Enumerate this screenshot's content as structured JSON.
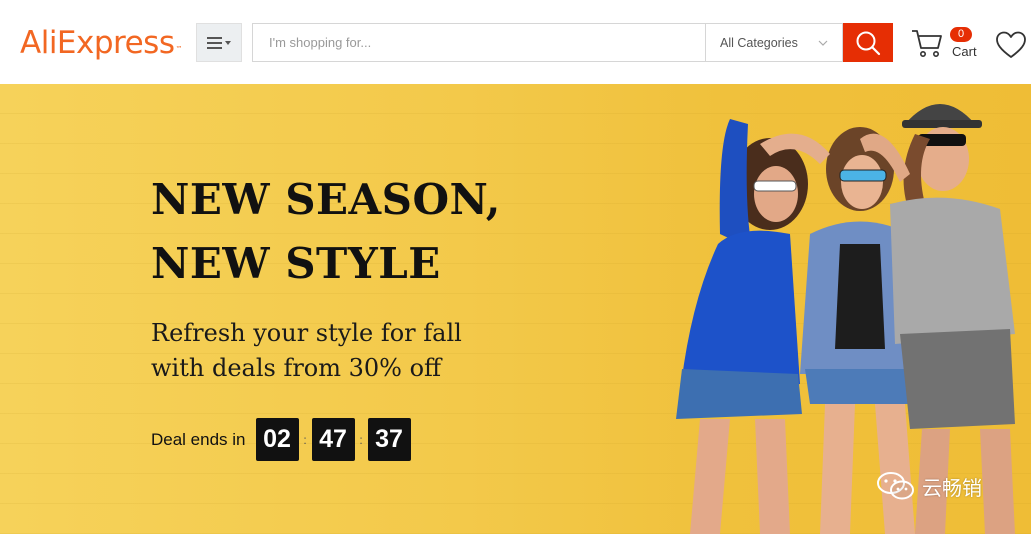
{
  "header": {
    "logo_text": "AliExpress",
    "logo_tm": "™",
    "menu_icon": "hamburger-dropdown-icon",
    "search": {
      "placeholder": "I'm shopping for..."
    },
    "category_select": {
      "selected": "All Categories"
    },
    "search_button_icon": "search-icon",
    "cart": {
      "count": "0",
      "label": "Cart"
    },
    "wishlist_icon": "heart-icon"
  },
  "hero": {
    "headline": [
      "NEW SEASON,",
      "NEW STYLE"
    ],
    "subtitle": [
      "Refresh your style for fall",
      "with deals from 30% off"
    ],
    "deal_label": "Deal ends in",
    "countdown": [
      "02",
      "47",
      "37"
    ]
  },
  "watermark": {
    "text": "云畅销"
  },
  "colors": {
    "brand": "#f26722",
    "accent": "#e62e04",
    "banner": "#f3c94a"
  }
}
